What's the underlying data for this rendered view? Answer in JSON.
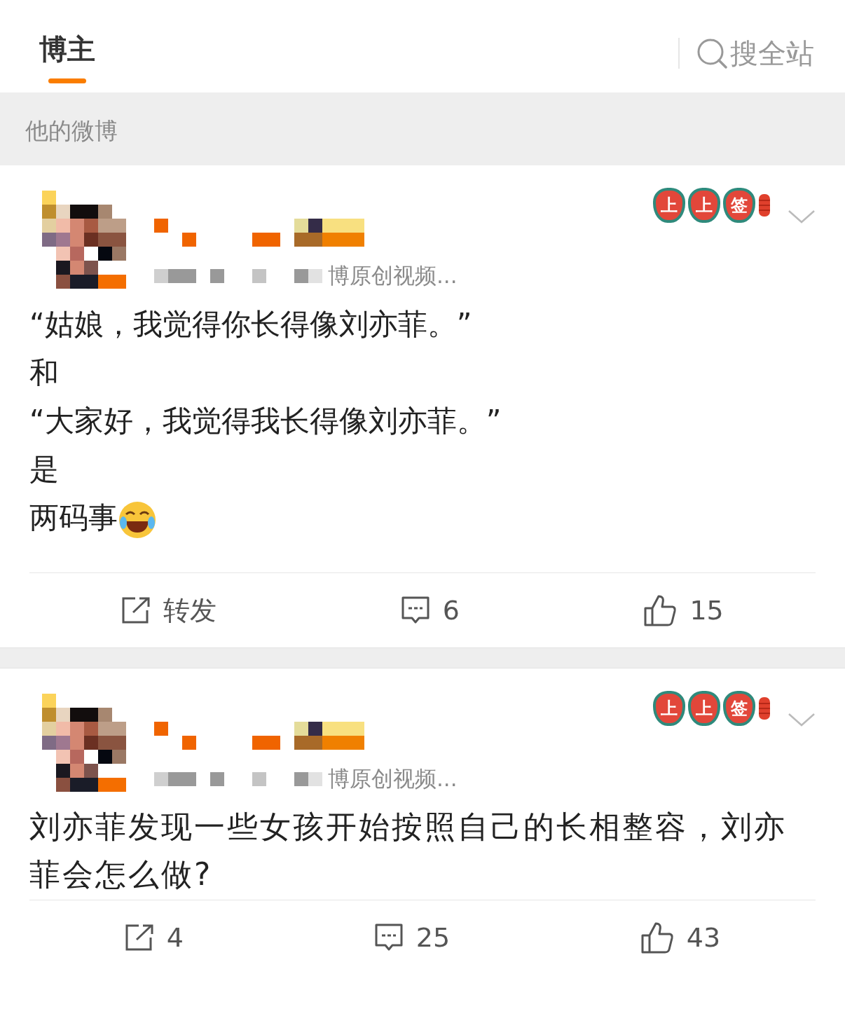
{
  "header": {
    "tabs": [
      {
        "label": "博主",
        "selected": true
      }
    ],
    "search_label": "搜全站"
  },
  "section_title": "他的微博",
  "posts": [
    {
      "source": "博原创视频...",
      "badge": [
        "上",
        "上",
        "签"
      ],
      "lines": [
        {
          "text": "“姑娘，我觉得你长得像刘亦菲。”",
          "has_emoji": false
        },
        {
          "text": "和",
          "has_emoji": false
        },
        {
          "text": "“大家好，我觉得我长得像刘亦菲。”",
          "has_emoji": false
        },
        {
          "text": "是",
          "has_emoji": false
        },
        {
          "text": "两码事",
          "has_emoji": true
        }
      ],
      "actions": {
        "repost": "转发",
        "comments": "6",
        "likes": "15"
      }
    },
    {
      "source": "博原创视频...",
      "badge": [
        "上",
        "上",
        "签"
      ],
      "lines": [
        {
          "text": "刘亦菲发现一些女孩开始按照自己的长相整容，刘亦菲会怎么做?",
          "has_emoji": false
        }
      ],
      "actions": {
        "repost": "4",
        "comments": "25",
        "likes": "43"
      }
    }
  ]
}
